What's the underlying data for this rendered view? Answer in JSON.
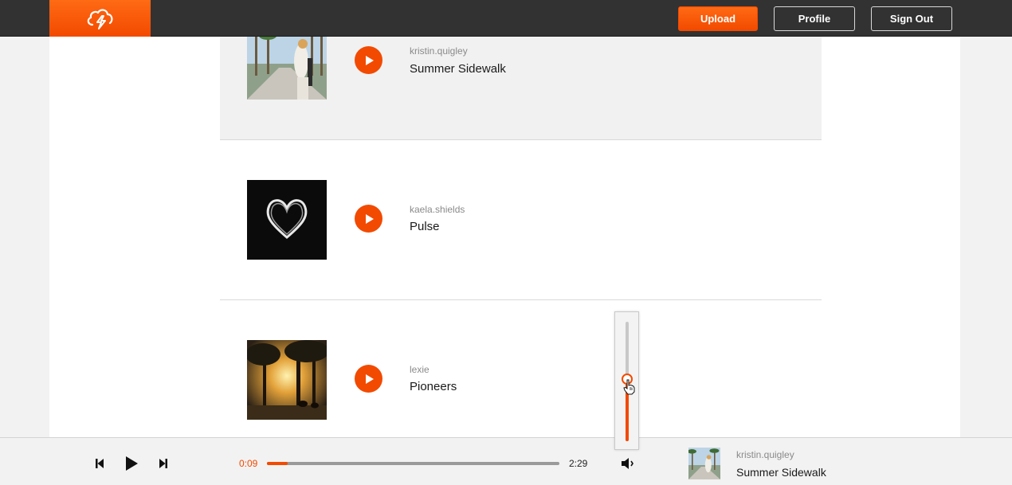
{
  "header": {
    "logo_icon": "cloud-bolt-icon",
    "upload_label": "Upload",
    "profile_label": "Profile",
    "signout_label": "Sign Out"
  },
  "tracks": [
    {
      "artist": "kristin.quigley",
      "title": "Summer Sidewalk",
      "artwork": "palm-street-photo",
      "active": true
    },
    {
      "artist": "kaela.shields",
      "title": "Pulse",
      "artwork": "light-heart-photo",
      "active": false
    },
    {
      "artist": "lexie",
      "title": "Pioneers",
      "artwork": "sunlit-forest-photo",
      "active": false
    }
  ],
  "player": {
    "current_time": "0:09",
    "total_time": "2:29",
    "progress": 0.07,
    "volume": 0.52,
    "now_playing": {
      "artist": "kristin.quigley",
      "title": "Summer Sidewalk",
      "artwork": "palm-street-photo"
    }
  },
  "colors": {
    "accent": "#f24a00",
    "topbar": "#323232",
    "background": "#f2f2f2",
    "content": "#ffffff"
  }
}
